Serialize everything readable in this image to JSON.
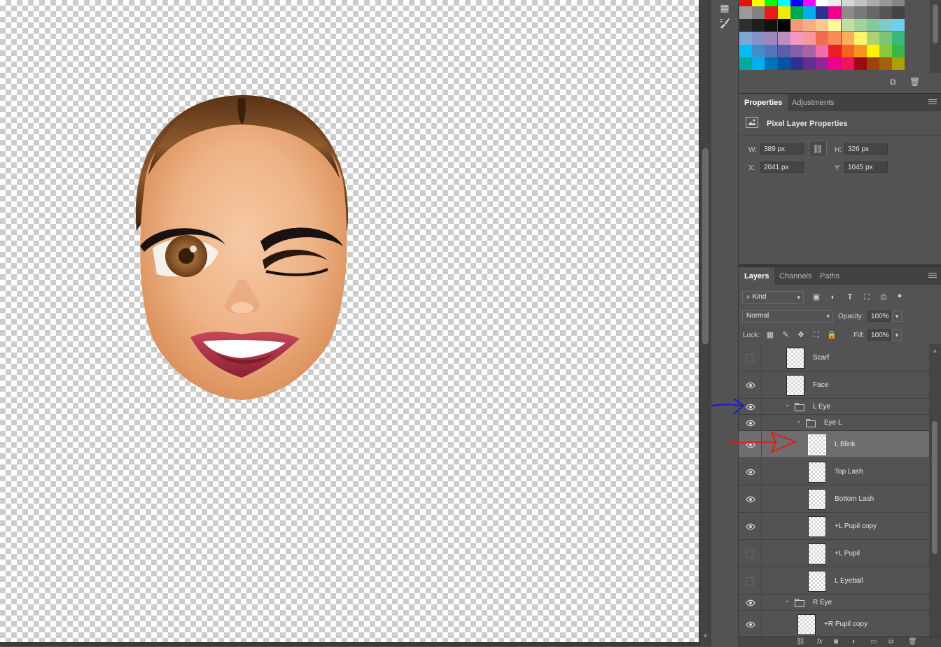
{
  "properties": {
    "tabs": [
      {
        "label": "Properties",
        "active": true
      },
      {
        "label": "Adjustments",
        "active": false
      }
    ],
    "title": "Pixel Layer Properties",
    "w_label": "W:",
    "w_value": "389 px",
    "h_label": "H:",
    "h_value": "326 px",
    "x_label": "X:",
    "x_value": "2041 px",
    "y_label": "Y:",
    "y_value": "1045 px"
  },
  "layers_panel": {
    "tabs": [
      {
        "label": "Layers",
        "active": true
      },
      {
        "label": "Channels",
        "active": false
      },
      {
        "label": "Paths",
        "active": false
      }
    ],
    "filter_label": "Kind",
    "blend_mode": "Normal",
    "opacity_label": "Opacity:",
    "opacity_value": "100%",
    "lock_label": "Lock:",
    "fill_label": "Fill:",
    "fill_value": "100%",
    "layers": [
      {
        "name": "Scarf",
        "visible": false,
        "type": "layer",
        "indent": 0
      },
      {
        "name": "Face",
        "visible": true,
        "type": "layer",
        "indent": 0
      },
      {
        "name": "L Eye",
        "visible": true,
        "type": "group",
        "indent": 0
      },
      {
        "name": "Eye L",
        "visible": true,
        "type": "group",
        "indent": 1
      },
      {
        "name": "L Blink",
        "visible": true,
        "type": "layer",
        "indent": 2,
        "selected": true
      },
      {
        "name": "Top Lash",
        "visible": true,
        "type": "layer",
        "indent": 2
      },
      {
        "name": "Bottom Lash",
        "visible": true,
        "type": "layer",
        "indent": 2
      },
      {
        "name": "+L Pupil copy",
        "visible": true,
        "type": "layer",
        "indent": 2
      },
      {
        "name": "+L Pupil",
        "visible": false,
        "type": "layer",
        "indent": 2
      },
      {
        "name": "L Eyeball",
        "visible": false,
        "type": "layer",
        "indent": 2
      },
      {
        "name": "R Eye",
        "visible": true,
        "type": "group",
        "indent": 0
      },
      {
        "name": "+R Pupil copy",
        "visible": true,
        "type": "layer",
        "indent": 1
      }
    ]
  },
  "annotations": {
    "blue_arrow_color": "#1a1ad6",
    "red_arrow_color": "#e01b1b"
  },
  "colors": {
    "ui_bg": "#535353",
    "selected_layer": "#6e6e6e"
  }
}
